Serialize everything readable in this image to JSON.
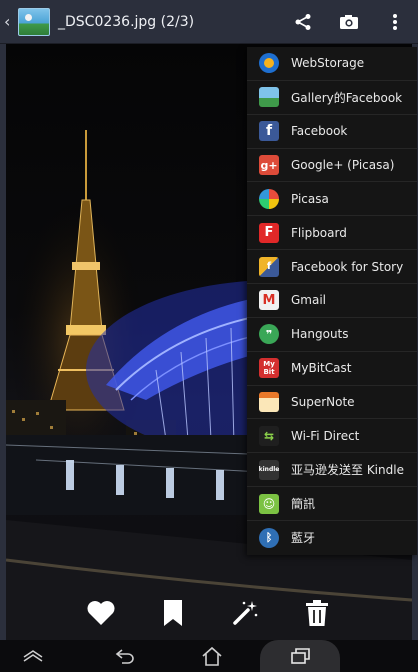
{
  "topbar": {
    "title": "_DSC0236.jpg (2/3)",
    "back_icon": "chevron-left-icon",
    "actions": [
      "share-icon",
      "camera-icon",
      "overflow-menu-icon"
    ]
  },
  "share_menu": {
    "items": [
      {
        "label": "WebStorage",
        "icon": "webstorage-icon",
        "color": "#f2a21b"
      },
      {
        "label": "Gallery的Facebook",
        "icon": "gallery-icon",
        "color": "#3fa0d8"
      },
      {
        "label": "Facebook",
        "icon": "facebook-icon",
        "color": "#3b5998"
      },
      {
        "label": "Google+ (Picasa)",
        "icon": "google-plus-icon",
        "color": "#dd4b39"
      },
      {
        "label": "Picasa",
        "icon": "picasa-icon",
        "color": "#e0e0e0"
      },
      {
        "label": "Flipboard",
        "icon": "flipboard-icon",
        "color": "#e12828"
      },
      {
        "label": "Facebook for Story",
        "icon": "facebook-story-icon",
        "color": "#f0b429"
      },
      {
        "label": "Gmail",
        "icon": "gmail-icon",
        "color": "#f1f1f1"
      },
      {
        "label": "Hangouts",
        "icon": "hangouts-icon",
        "color": "#3aa757"
      },
      {
        "label": "MyBitCast",
        "icon": "mybitcast-icon",
        "color": "#d32f2f"
      },
      {
        "label": "SuperNote",
        "icon": "supernote-icon",
        "color": "#f4a62a"
      },
      {
        "label": "Wi-Fi Direct",
        "icon": "wifi-direct-icon",
        "color": "#1f1f1f"
      },
      {
        "label": "亚马逊发送至 Kindle",
        "icon": "kindle-icon",
        "color": "#333333"
      },
      {
        "label": "簡訊",
        "icon": "messaging-icon",
        "color": "#7cc243"
      },
      {
        "label": "藍牙",
        "icon": "bluetooth-icon",
        "color": "#2f6fb5"
      }
    ]
  },
  "tools": [
    "heart-icon",
    "bookmark-icon",
    "magic-wand-icon",
    "trash-icon"
  ],
  "navbar": [
    "hide-bar-icon",
    "back-icon",
    "home-icon",
    "recent-apps-icon"
  ]
}
